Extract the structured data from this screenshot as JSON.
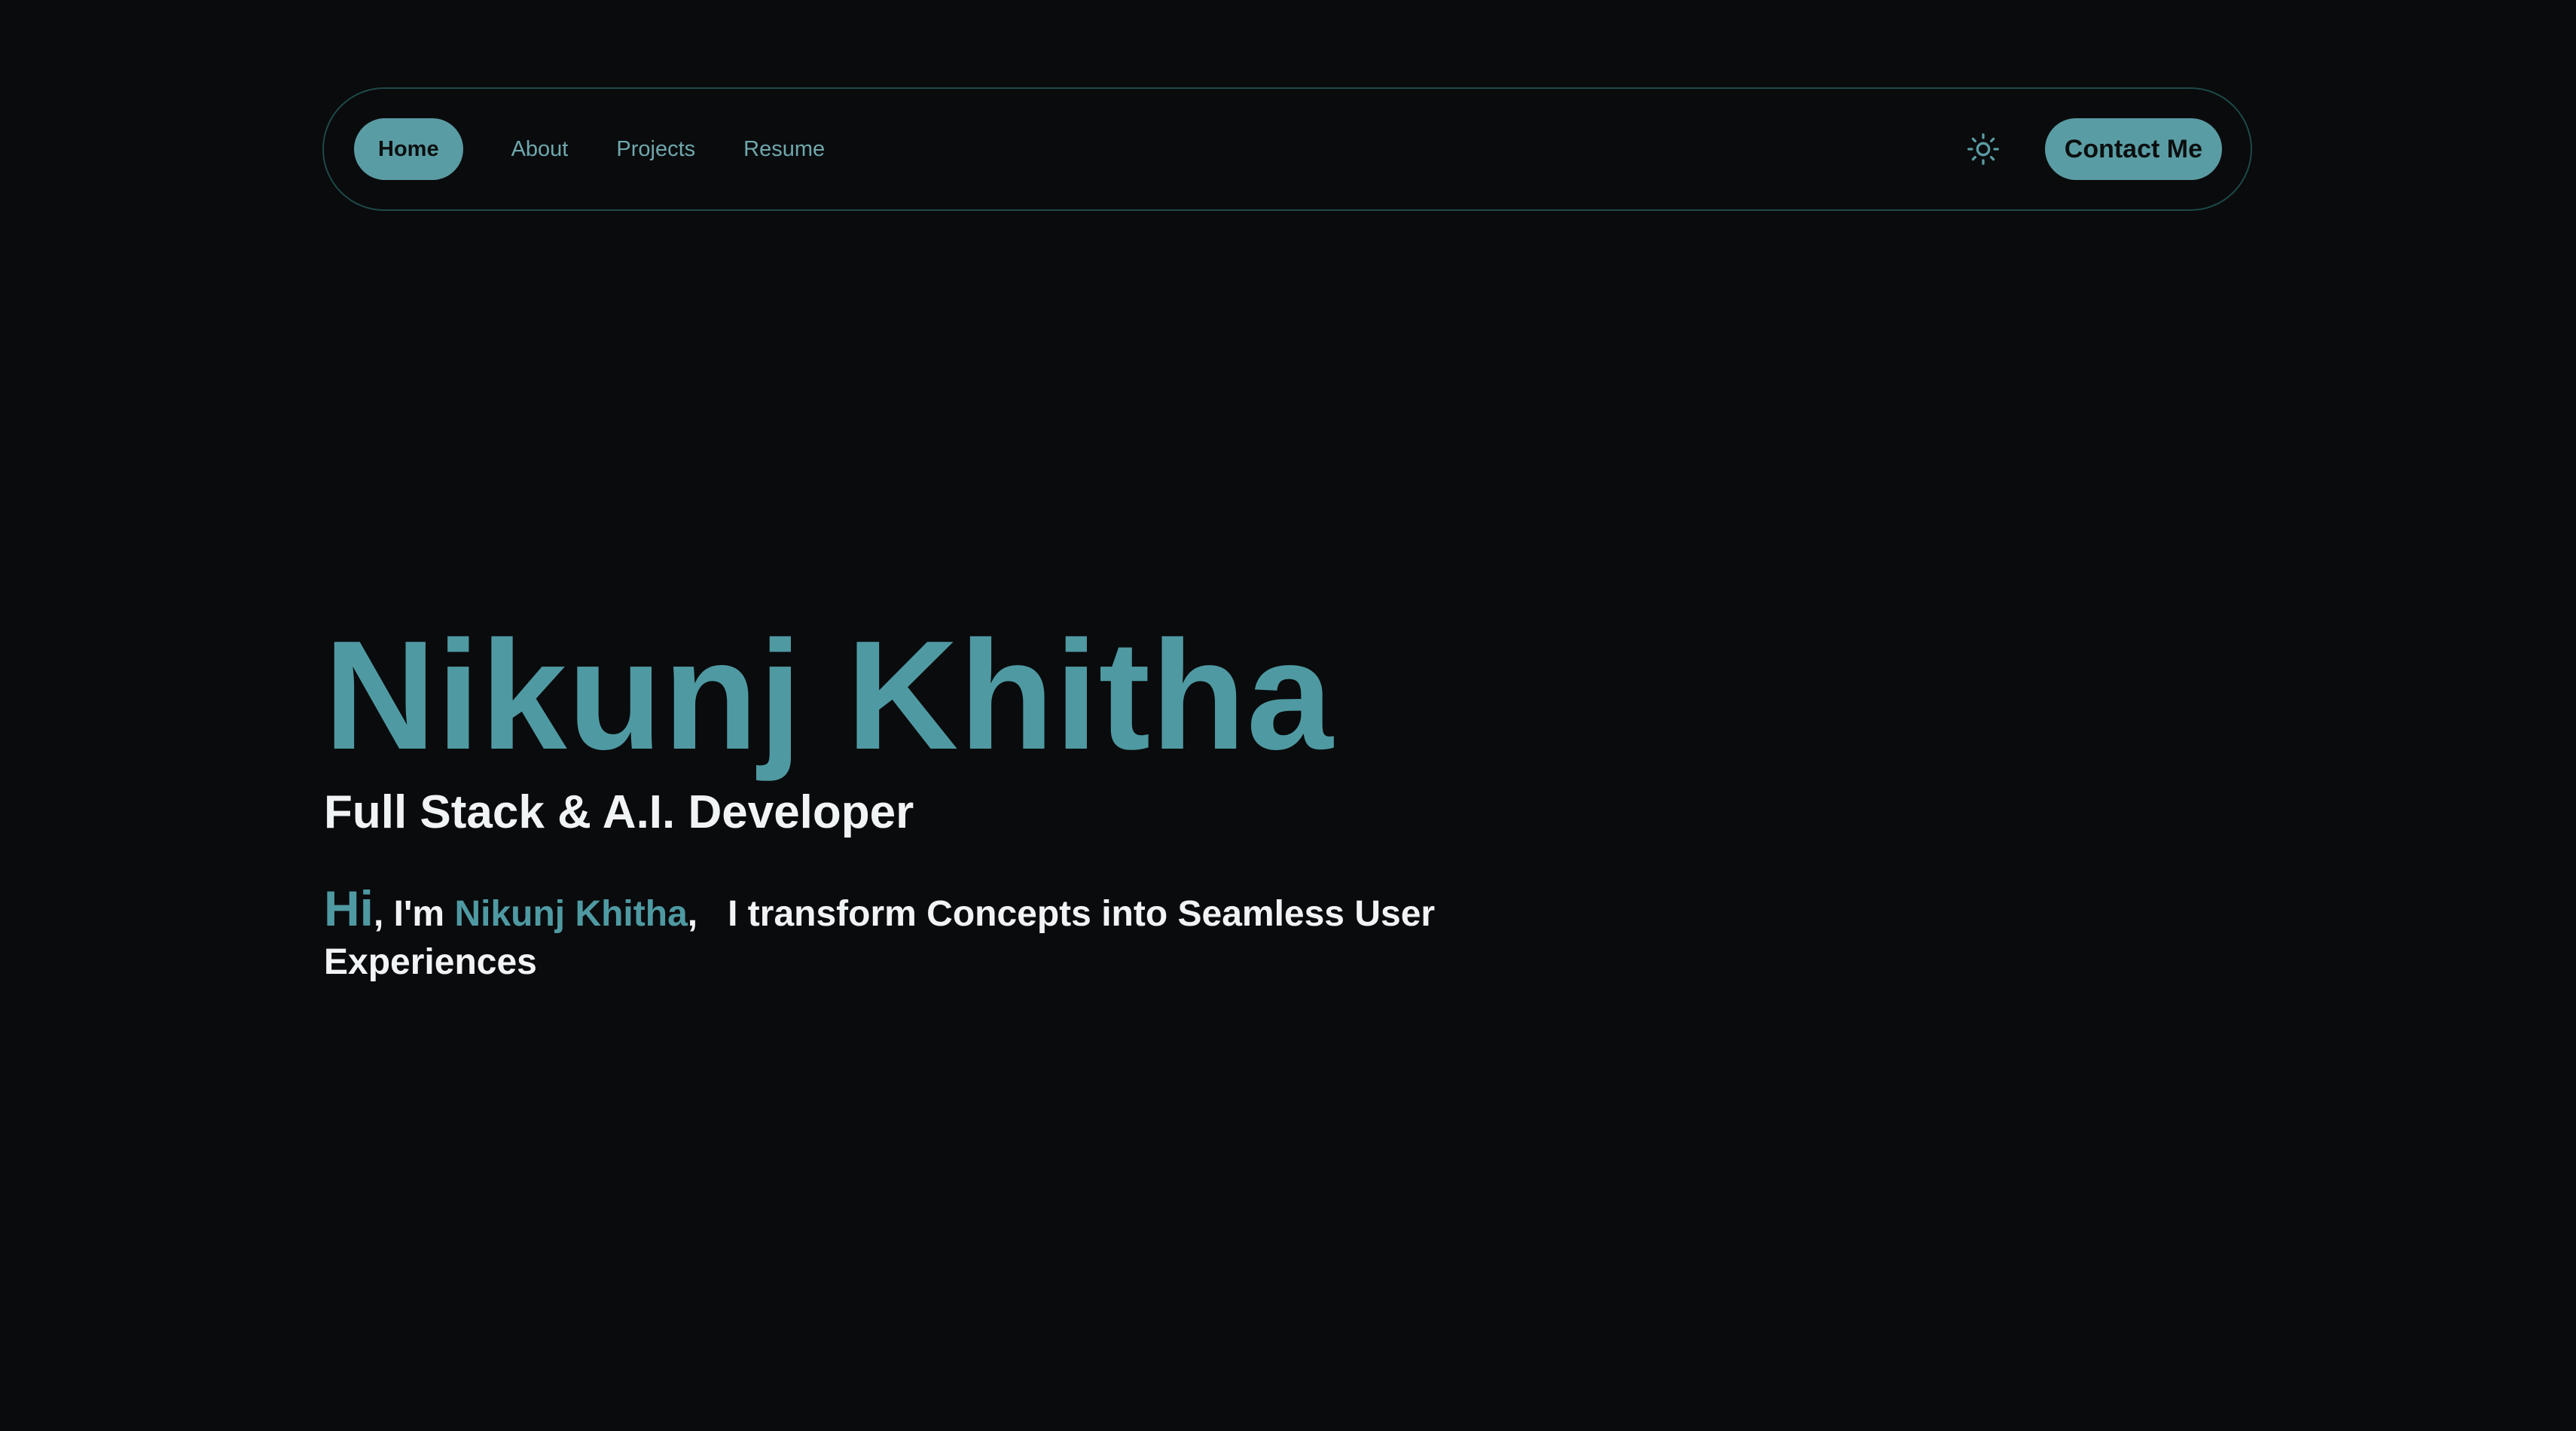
{
  "nav": {
    "items": [
      {
        "label": "Home"
      },
      {
        "label": "About"
      },
      {
        "label": "Projects"
      },
      {
        "label": "Resume"
      }
    ],
    "theme_toggle_icon": "sun-icon",
    "contact_label": "Contact Me"
  },
  "hero": {
    "name": "Nikunj Khitha",
    "role": "Full Stack & A.I. Developer",
    "intro": {
      "hi": "Hi",
      "im": ", I'm ",
      "name": "Nikunj Khitha",
      "rest": ",   I transform Concepts into Seamless User Experiences"
    }
  },
  "colors": {
    "background": "#0a0b0d",
    "accent": "#5a9ca3",
    "text": "#f1f4f4",
    "border": "#1d4a48"
  }
}
